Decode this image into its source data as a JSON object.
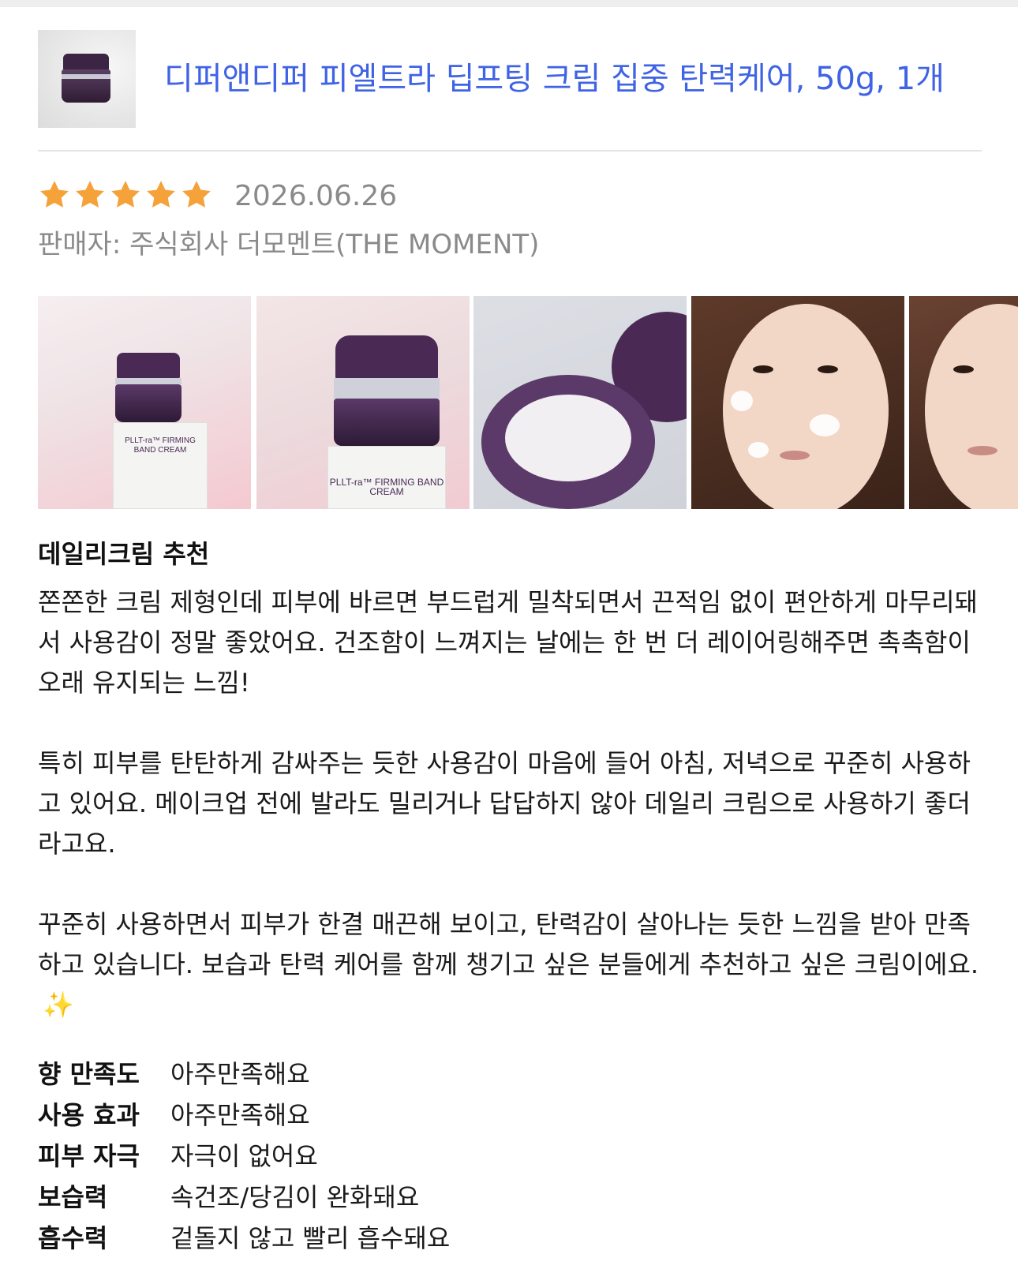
{
  "product": {
    "title": "디퍼앤디퍼 피엘트라 딥프팅 크림 집중 탄력케어, 50g, 1개",
    "link_color": "#3f63e4"
  },
  "review": {
    "rating": 5,
    "rating_max": 5,
    "star_color": "#f5a23a",
    "date": "2026.06.26",
    "seller_label": "판매자:",
    "seller_name": "주식회사 더모멘트(THE MOMENT)",
    "photos": [
      {
        "icon": "product-box-photo",
        "box_text": "PLLT-ra™ FIRMING BAND CREAM"
      },
      {
        "icon": "product-jar-photo",
        "box_text": "PLLT-ra™ FIRMING BAND CREAM"
      },
      {
        "icon": "open-jar-photo"
      },
      {
        "icon": "face-application-photo"
      },
      {
        "icon": "face-application-photo"
      }
    ],
    "headline": "데일리크림 추천",
    "paragraphs": [
      "쫀쫀한 크림 제형인데 피부에 바르면 부드럽게 밀착되면서 끈적임 없이 편안하게 마무리돼서 사용감이 정말 좋았어요. 건조함이 느껴지는 날에는 한 번 더 레이어링해주면 촉촉함이 오래 유지되는 느낌!",
      "특히 피부를 탄탄하게 감싸주는 듯한 사용감이 마음에 들어 아침, 저녁으로 꾸준히 사용하고 있어요. 메이크업 전에 발라도 밀리거나 답답하지 않아 데일리 크림으로 사용하기 좋더라고요.",
      "꾸준히 사용하면서 피부가 한결 매끈해 보이고, 탄력감이 살아나는 듯한 느낌을 받아 만족하고 있습니다. 보습과 탄력 케어를 함께 챙기고 싶은 분들에게 추천하고 싶은 크림이에요."
    ],
    "sparkle": "✨",
    "survey": [
      {
        "question": "향 만족도",
        "answer": "아주만족해요"
      },
      {
        "question": "사용 효과",
        "answer": "아주만족해요"
      },
      {
        "question": "피부 자극",
        "answer": "자극이 없어요"
      },
      {
        "question": "보습력",
        "answer": "속건조/당김이 완화돼요"
      },
      {
        "question": "흡수력",
        "answer": "겉돌지 않고 빨리 흡수돼요"
      }
    ]
  }
}
